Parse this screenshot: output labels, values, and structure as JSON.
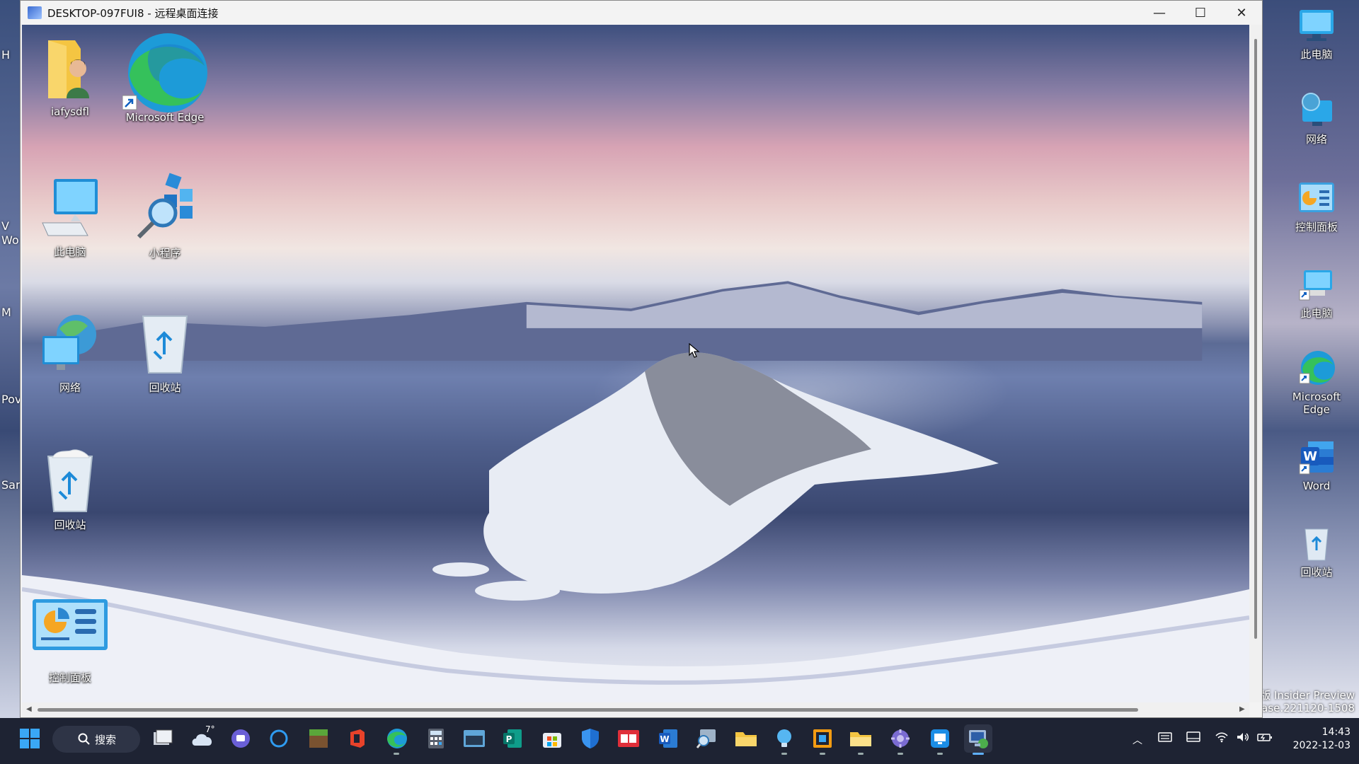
{
  "rdp_window": {
    "title": "DESKTOP-097FUI8 - 远程桌面连接",
    "minimize_symbol": "—",
    "maximize_symbol": "☐",
    "close_symbol": "✕"
  },
  "remote_desktop": {
    "icons": [
      {
        "label": "iafysdfl",
        "icon": "user-folder-icon"
      },
      {
        "label": "Microsoft Edge",
        "icon": "edge-icon"
      },
      {
        "label": "此电脑",
        "icon": "this-pc-icon"
      },
      {
        "label": "小程序",
        "icon": "applet-icon"
      },
      {
        "label": "网络",
        "icon": "network-icon"
      },
      {
        "label": "回收站",
        "icon": "recycle-bin-icon"
      },
      {
        "label": "回收站",
        "icon": "recycle-bin-icon"
      },
      {
        "label": "控制面板",
        "icon": "control-panel-icon"
      }
    ]
  },
  "host_desktop": {
    "left_labels": [
      "H",
      "V",
      "Wo",
      "M",
      "Pov",
      "San"
    ],
    "right_icons": [
      {
        "label": "此电脑",
        "icon": "monitor-icon"
      },
      {
        "label": "网络",
        "icon": "network-icon"
      },
      {
        "label": "控制面板",
        "icon": "control-panel-icon"
      },
      {
        "label": "此电脑",
        "icon": "this-pc-shortcut-icon"
      },
      {
        "label": "Microsoft Edge",
        "icon": "edge-icon"
      },
      {
        "label": "Word",
        "icon": "word-icon"
      },
      {
        "label": "回收站",
        "icon": "recycle-bin-icon"
      }
    ],
    "watermark_line1": "版 Insider Preview",
    "watermark_line2": "ease.221120-1508"
  },
  "taskbar": {
    "search_label": "搜索",
    "weather_temp": "7°",
    "time": "14:43",
    "date": "2022-12-03",
    "colors": {
      "background": "#1e2333",
      "accent": "#0078d4"
    }
  }
}
